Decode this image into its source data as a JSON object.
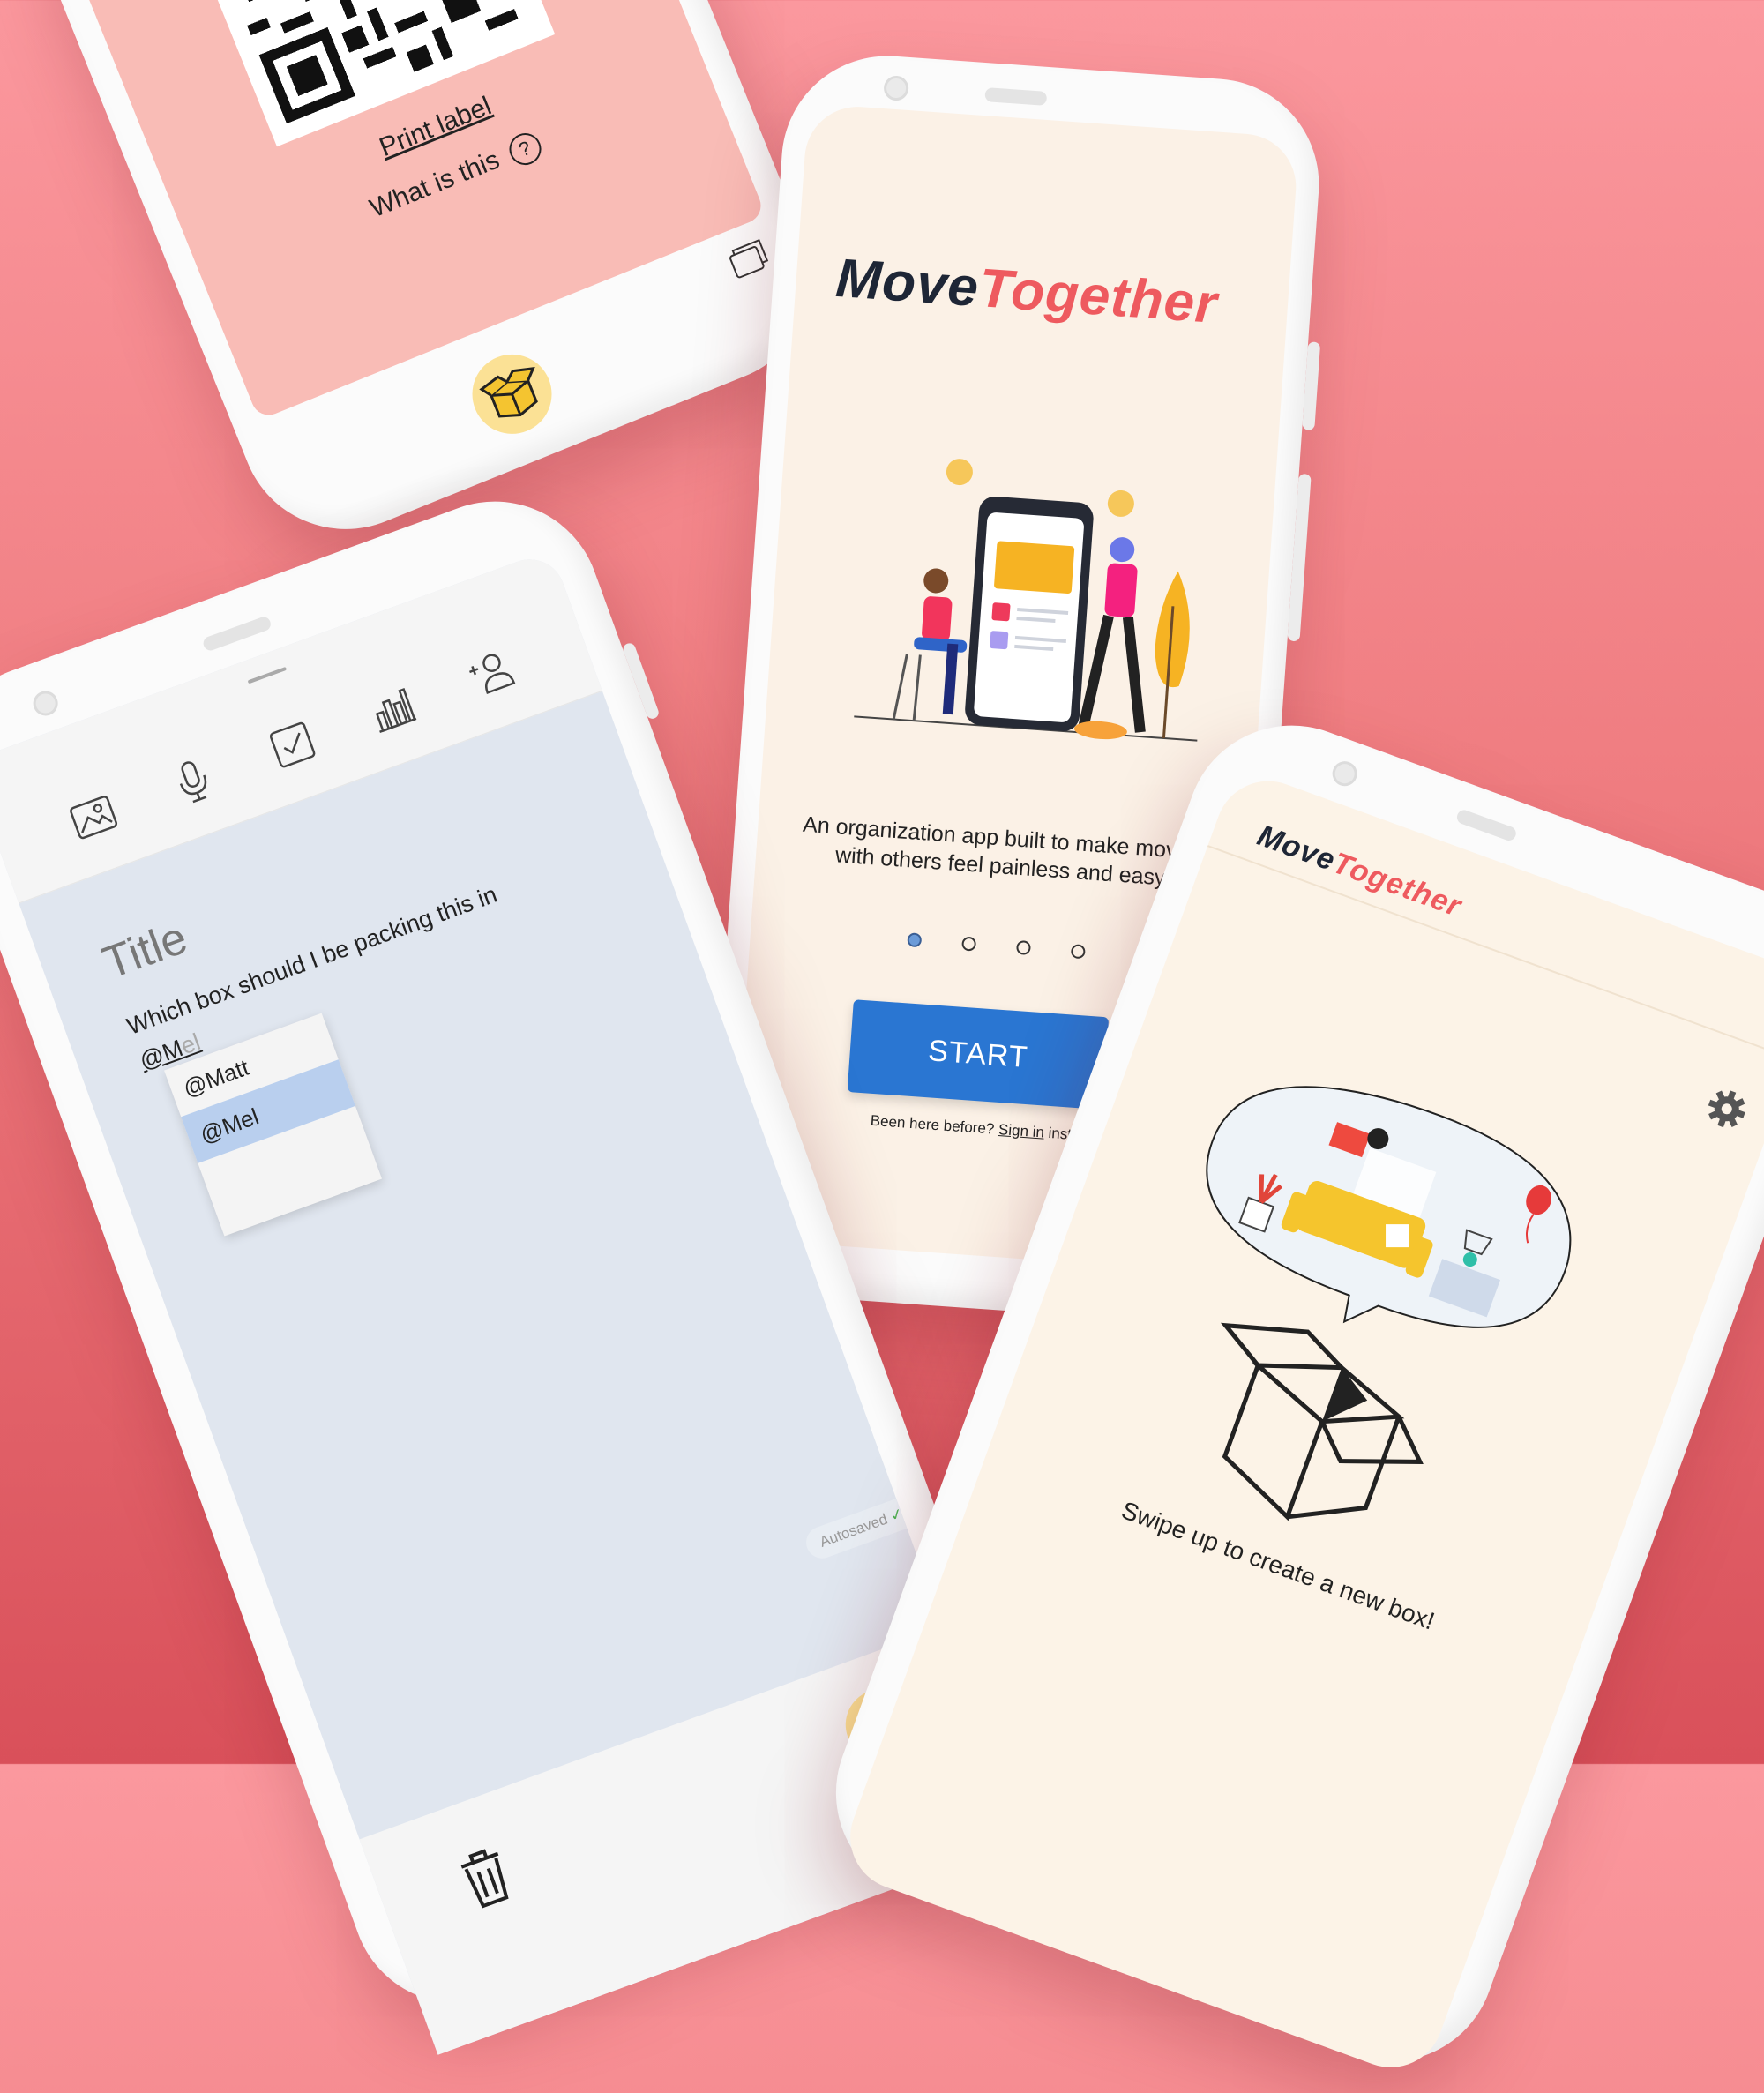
{
  "qr_screen": {
    "print_label": "Print label",
    "what_is_this": "What is this",
    "help_icon": "?"
  },
  "welcome_screen": {
    "logo": {
      "move": "Move",
      "together": "Together"
    },
    "tagline_line1": "An organization app built to make moving",
    "tagline_line2": "with others feel painless and easy.",
    "pager": {
      "pages": 4,
      "current": 1
    },
    "start_label": "START",
    "signin": {
      "prefix": "Been here before?",
      "link": "Sign in",
      "suffix": "instead"
    },
    "colors": {
      "accent": "#2a76d2",
      "brand_dark": "#1e2636",
      "brand_red": "#ee5a5f"
    }
  },
  "note_screen": {
    "toolbar_icons": [
      "image-icon",
      "microphone-icon",
      "checkbox-icon",
      "chart-icon",
      "add-person-icon"
    ],
    "title_placeholder": "Title",
    "body_text": "Which box should I be packing this in",
    "mention_typed": "@M",
    "mention_ghost": "el",
    "mention_options": [
      "@Matt",
      "@Mel"
    ],
    "mention_selected": "@Mel",
    "autosave_label": "Autosaved",
    "autosave_check": "✓"
  },
  "home_screen": {
    "logo": {
      "move": "Move",
      "together": "Together"
    },
    "swipe_hint": "Swipe up to create a new box!"
  }
}
